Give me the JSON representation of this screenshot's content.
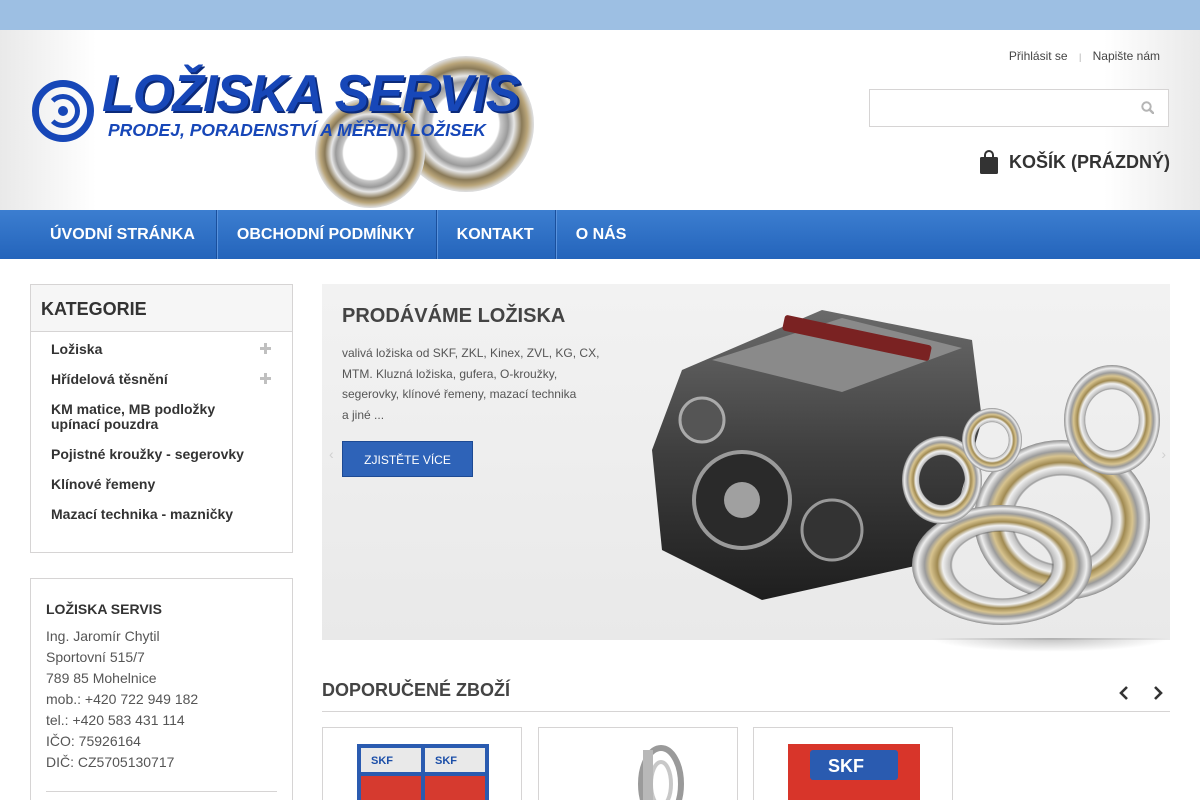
{
  "header": {
    "logo": {
      "title": "LOŽISKA SERVIS",
      "subtitle": "PRODEJ, PORADENSTVÍ A MĚŘENÍ LOŽISEK"
    },
    "user_links": {
      "login": "Přihlásit se",
      "contact": "Napište nám"
    },
    "search": {
      "placeholder": "",
      "icon": "search-icon"
    },
    "cart": {
      "label": "KOŠÍK (PRÁZDNÝ)",
      "icon": "shopping-bag-icon"
    }
  },
  "nav": {
    "items": [
      {
        "label": "ÚVODNÍ STRÁNKA"
      },
      {
        "label": "OBCHODNÍ PODMÍNKY"
      },
      {
        "label": "KONTAKT"
      },
      {
        "label": "O NÁS"
      }
    ]
  },
  "sidebar": {
    "title": "KATEGORIE",
    "items": [
      {
        "label": "Ložiska",
        "expandable": true
      },
      {
        "label": "Hřídelová těsnění",
        "expandable": true
      },
      {
        "label": "KM matice, MB podložky upínací pouzdra",
        "expandable": false
      },
      {
        "label": "Pojistné kroužky - segerovky",
        "expandable": false
      },
      {
        "label": "Klínové řemeny",
        "expandable": false
      },
      {
        "label": "Mazací technika - mazničky",
        "expandable": false
      }
    ]
  },
  "contact": {
    "title": "LOŽISKA SERVIS",
    "lines": [
      "Ing. Jaromír Chytil",
      "Sportovní 515/7",
      "789 85 Mohelnice",
      "mob.: +420 722 949 182",
      "tel.: +420 583 431 114",
      "IČO: 75926164",
      "DIČ: CZ5705130717"
    ]
  },
  "slider": {
    "title": "PRODÁVÁME LOŽISKA",
    "text_lines": [
      "valivá ložiska od SKF, ZKL, Kinex, ZVL, KG, CX,",
      "MTM. Kluzná ložiska, gufera, O-kroužky,",
      "segerovky, klínové řemeny, mazací technika",
      "a jiné ..."
    ],
    "button": "ZJISTĚTE VÍCE",
    "prev_icon": "chevron-left-icon",
    "next_icon": "chevron-right-icon"
  },
  "featured": {
    "title": "DOPORUČENÉ ZBOŽÍ",
    "prev_icon": "chevron-left-icon",
    "next_icon": "chevron-right-icon",
    "brand_label": "SKF"
  },
  "colors": {
    "top_strip": "#9dbfe3",
    "nav": "#2a6bc2",
    "brand_blue": "#1747b8",
    "button": "#2e63b8"
  }
}
